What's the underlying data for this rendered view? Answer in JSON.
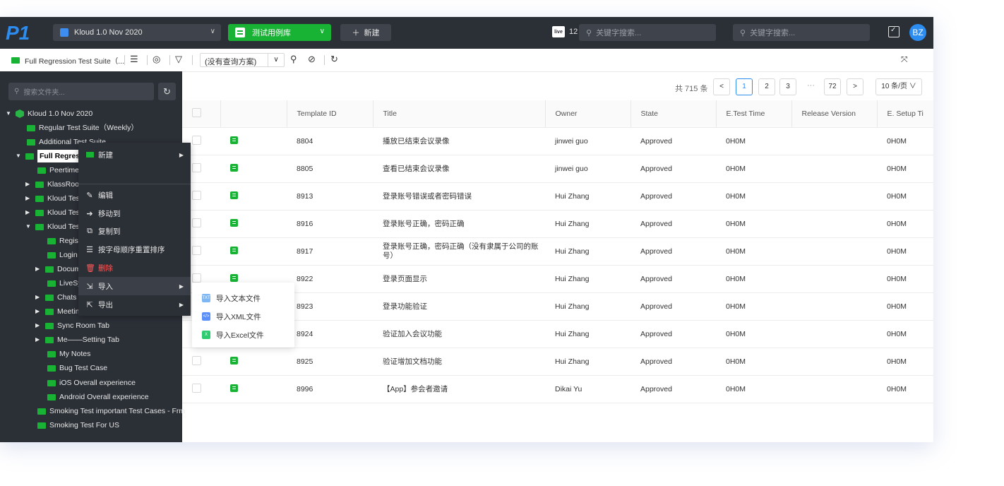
{
  "topbar": {
    "logo": "P1",
    "project": "Kloud 1.0 Nov 2020",
    "library": "测试用例库",
    "new_label": "新建",
    "live_icon": "live",
    "live_count": "12",
    "search1_placeholder": "关键字搜索...",
    "search2_placeholder": "关键字搜索...",
    "avatar": "BZ"
  },
  "toolbar": {
    "suite": "Full Regression Test Suite（...",
    "query_scheme": "(没有查询方案)"
  },
  "sidebar": {
    "search_placeholder": "搜索文件夹...",
    "items": [
      {
        "label": "Kloud 1.0 Nov 2020"
      },
      {
        "label": "Regular Test Suite（Weekly）"
      },
      {
        "label": "Additional Test Suite"
      },
      {
        "label": "Full Regression Test Suite"
      },
      {
        "label": "Peertime"
      },
      {
        "label": "KlassRoom"
      },
      {
        "label": "Kloud Test"
      },
      {
        "label": "Kloud Test"
      },
      {
        "label": "Kloud Test"
      },
      {
        "label": "Register"
      },
      {
        "label": "Login"
      },
      {
        "label": "Documents"
      },
      {
        "label": "LiveSync"
      },
      {
        "label": "Chats Tab"
      },
      {
        "label": "Meetings Tab"
      },
      {
        "label": "Sync Room Tab"
      },
      {
        "label": "Me——Setting Tab"
      },
      {
        "label": "My Notes"
      },
      {
        "label": "Bug Test Case"
      },
      {
        "label": "iOS Overall experience"
      },
      {
        "label": "Android Overall experience"
      },
      {
        "label": "Smoking Test important Test Cases - Frm"
      },
      {
        "label": "Smoking Test For US"
      }
    ]
  },
  "context_menu": {
    "items": [
      {
        "label": "新建"
      },
      {
        "label": "编辑"
      },
      {
        "label": "移动到"
      },
      {
        "label": "复制到"
      },
      {
        "label": "按字母顺序重置排序"
      },
      {
        "label": "删除"
      },
      {
        "label": "导入"
      },
      {
        "label": "导出"
      }
    ],
    "import_submenu": [
      {
        "badge": "TXT",
        "label": "导入文本文件",
        "color": "#7fb7f5"
      },
      {
        "badge": "</>",
        "label": "导入XML文件",
        "color": "#5b8ff9"
      },
      {
        "badge": "X",
        "label": "导入Excel文件",
        "color": "#2ecc71"
      }
    ]
  },
  "pagination": {
    "total": "共 715 条",
    "prev": "<",
    "pages": [
      "1",
      "2",
      "3"
    ],
    "ellipsis": "···",
    "last": "72",
    "next": ">",
    "page_size": "10 条/页 ∨"
  },
  "table": {
    "columns": [
      "Template ID",
      "Title",
      "Owner",
      "State",
      "E.Test Time",
      "Release Version",
      "E. Setup Ti"
    ],
    "rows": [
      {
        "id": "8804",
        "title": "播放已结束会议录像",
        "owner": "jinwei guo",
        "state": "Approved",
        "ett": "0H0M",
        "rv": "",
        "est": "0H0M"
      },
      {
        "id": "8805",
        "title": "查看已结束会议录像",
        "owner": "jinwei guo",
        "state": "Approved",
        "ett": "0H0M",
        "rv": "",
        "est": "0H0M"
      },
      {
        "id": "8913",
        "title": "登录账号错误或者密码错误",
        "owner": "Hui Zhang",
        "state": "Approved",
        "ett": "0H0M",
        "rv": "",
        "est": "0H0M"
      },
      {
        "id": "8916",
        "title": "登录账号正确，密码正确",
        "owner": "Hui Zhang",
        "state": "Approved",
        "ett": "0H0M",
        "rv": "",
        "est": "0H0M"
      },
      {
        "id": "8917",
        "title": "登录账号正确，密码正确（没有隶属于公司的账号）",
        "owner": "Hui Zhang",
        "state": "Approved",
        "ett": "0H0M",
        "rv": "",
        "est": "0H0M"
      },
      {
        "id": "8922",
        "title": "登录页面显示",
        "owner": "Hui Zhang",
        "state": "Approved",
        "ett": "0H0M",
        "rv": "",
        "est": "0H0M"
      },
      {
        "id": "8923",
        "title": "登录功能验证",
        "owner": "Hui Zhang",
        "state": "Approved",
        "ett": "0H0M",
        "rv": "",
        "est": "0H0M"
      },
      {
        "id": "8924",
        "title": "验证加入会议功能",
        "owner": "Hui Zhang",
        "state": "Approved",
        "ett": "0H0M",
        "rv": "",
        "est": "0H0M"
      },
      {
        "id": "8925",
        "title": "验证增加文档功能",
        "owner": "Hui Zhang",
        "state": "Approved",
        "ett": "0H0M",
        "rv": "",
        "est": "0H0M"
      },
      {
        "id": "8996",
        "title": "【App】参会者邀请",
        "owner": "Dikai Yu",
        "state": "Approved",
        "ett": "0H0M",
        "rv": "",
        "est": "0H0M"
      }
    ]
  }
}
